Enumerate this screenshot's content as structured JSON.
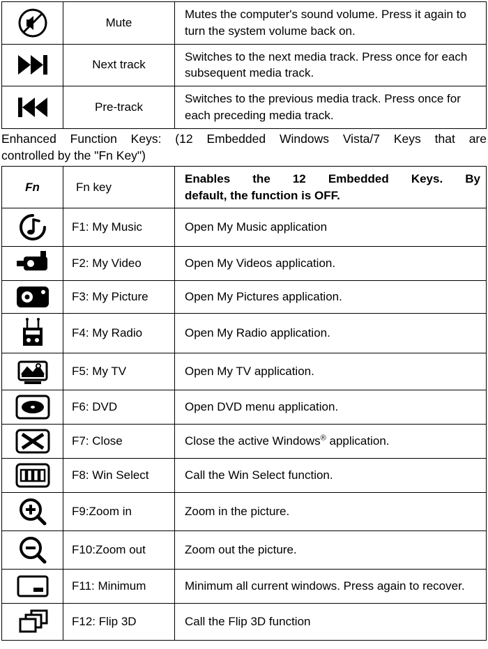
{
  "media": {
    "rows": [
      {
        "key": "Mute",
        "desc": "Mutes the computer's sound volume. Press it again to turn the system volume back on."
      },
      {
        "key": "Next track",
        "desc": "Switches to the next media track. Press once for each subsequent media track."
      },
      {
        "key": "Pre-track",
        "desc": "Switches to the previous media track. Press once for each preceding media track."
      }
    ]
  },
  "caption_line1": "Enhanced Function Keys: (12 Embedded Windows Vista/7 Keys that are",
  "caption_line2": "controlled by the \"Fn Key\")",
  "fn_header": {
    "label_italic": "Fn",
    "key": "Fn key",
    "desc_line1": "Enables the 12 Embedded Keys. By",
    "desc_line2": "default, the function is OFF."
  },
  "fn_rows": [
    {
      "key": "F1: My Music",
      "desc": "Open My Music application"
    },
    {
      "key": "F2: My Video",
      "desc": "Open My Videos application."
    },
    {
      "key": "F3: My Picture",
      "desc": "Open My Pictures application."
    },
    {
      "key": "F4: My Radio",
      "desc": "Open My Radio application."
    },
    {
      "key": "F5: My TV",
      "desc": "Open My TV application."
    },
    {
      "key": "F6: DVD",
      "desc": "Open DVD menu application."
    },
    {
      "key": "F7: Close",
      "desc_pre": "Close the active Windows",
      "desc_sup": "®",
      "desc_post": " application."
    },
    {
      "key": "F8: Win Select",
      "desc": "Call the Win Select function."
    },
    {
      "key": "F9:Zoom in",
      "desc": "Zoom in the picture."
    },
    {
      "key": "F10:Zoom out",
      "desc": "Zoom out the picture."
    },
    {
      "key": "F11: Minimum",
      "desc": "Minimum all current windows. Press again to recover."
    },
    {
      "key": "F12: Flip 3D",
      "desc": "Call the Flip 3D function"
    }
  ]
}
